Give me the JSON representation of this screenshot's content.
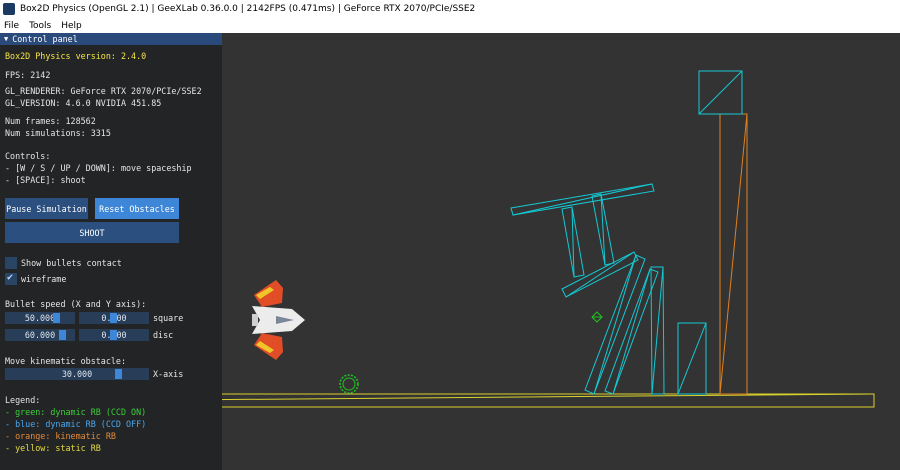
{
  "window": {
    "title": "Box2D Physics (OpenGL 2.1) | GeeXLab 0.36.0.0 | 2142FPS (0.471ms) | GeForce RTX 2070/PCIe/SSE2"
  },
  "menu": [
    "File",
    "Tools",
    "Help"
  ],
  "panel": {
    "header": "Control panel",
    "version": "Box2D Physics version: 2.4.0",
    "fps": "FPS: 2142",
    "gl_renderer": "GL_RENDERER: GeForce RTX 2070/PCIe/SSE2",
    "gl_version": "GL_VERSION: 4.6.0 NVIDIA 451.85",
    "num_frames": "Num frames: 128562",
    "num_simulations": "Num simulations: 3315",
    "controls_title": "Controls:",
    "control_move": "- [W / S / UP / DOWN]: move spaceship",
    "control_shoot": "- [SPACE]: shoot",
    "pause_button": "Pause Simulation",
    "reset_button": "Reset Obstacles",
    "shoot_button": "SHOOT",
    "show_bullets_label": "Show bullets contact",
    "show_bullets_checked": false,
    "wireframe_label": "wireframe",
    "wireframe_checked": true,
    "bullet_speed_title": "Bullet speed (X and Y axis):",
    "square_x": "50.000",
    "square_y": "0.000",
    "square_label": "square",
    "disc_x": "60.000",
    "disc_y": "0.000",
    "disc_label": "disc",
    "kinematic_title": "Move kinematic obstacle:",
    "kinematic_value": "30.000",
    "kinematic_label": "X-axis",
    "legend_title": "Legend:",
    "legend_green": "- green: dynamic RB (CCD ON)",
    "legend_blue": "- blue: dynamic RB (CCD OFF)",
    "legend_orange": "- orange: kinematic RB",
    "legend_yellow": "- yellow: static RB"
  },
  "colors": {
    "dynamic_ccd_on": "#21c321",
    "dynamic_ccd_off": "#14c8d4",
    "kinematic": "#e0801f",
    "static": "#d8d22e",
    "viewport_bg": "#333333",
    "panel_bg": "#232425",
    "accent": "#3d86d8"
  },
  "icons": {
    "app": "box2d-app-icon",
    "spaceship": "spaceship-icon",
    "collapse": "triangle-down-icon",
    "check": "checkmark-icon"
  }
}
